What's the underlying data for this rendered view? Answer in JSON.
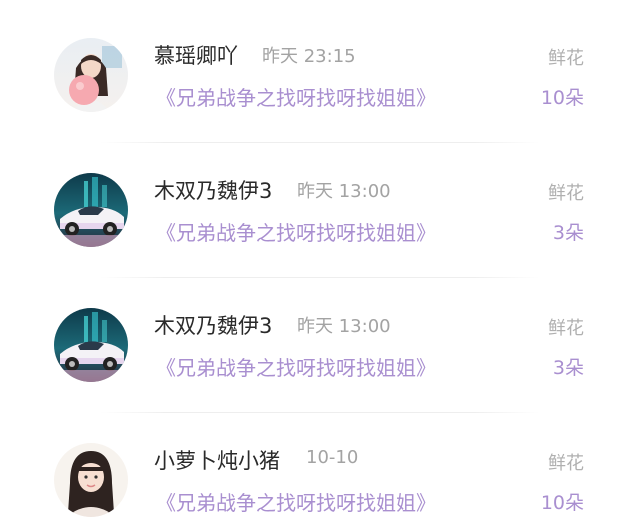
{
  "records": [
    {
      "user": "慕瑶卿吖",
      "time": "昨天 23:15",
      "book": "《兄弟战争之找呀找呀找姐姐》",
      "gift_label": "鲜花",
      "gift_count": "10朵",
      "avatar_icon": "girl-balloon-avatar"
    },
    {
      "user": "木双乃魏伊3",
      "time": "昨天 13:00",
      "book": "《兄弟战争之找呀找呀找姐姐》",
      "gift_label": "鲜花",
      "gift_count": "3朵",
      "avatar_icon": "white-sports-car-avatar"
    },
    {
      "user": "木双乃魏伊3",
      "time": "昨天 13:00",
      "book": "《兄弟战争之找呀找呀找姐姐》",
      "gift_label": "鲜花",
      "gift_count": "3朵",
      "avatar_icon": "white-sports-car-avatar"
    },
    {
      "user": "小萝卜炖小猪",
      "time": "10-10",
      "book": "《兄弟战争之找呀找呀找姐姐》",
      "gift_label": "鲜花",
      "gift_count": "10朵",
      "avatar_icon": "girl-portrait-avatar"
    }
  ],
  "colors": {
    "accent_purple": "#a98fd0",
    "name_text": "#2a2a2a",
    "muted_text": "#a3a3a3"
  }
}
